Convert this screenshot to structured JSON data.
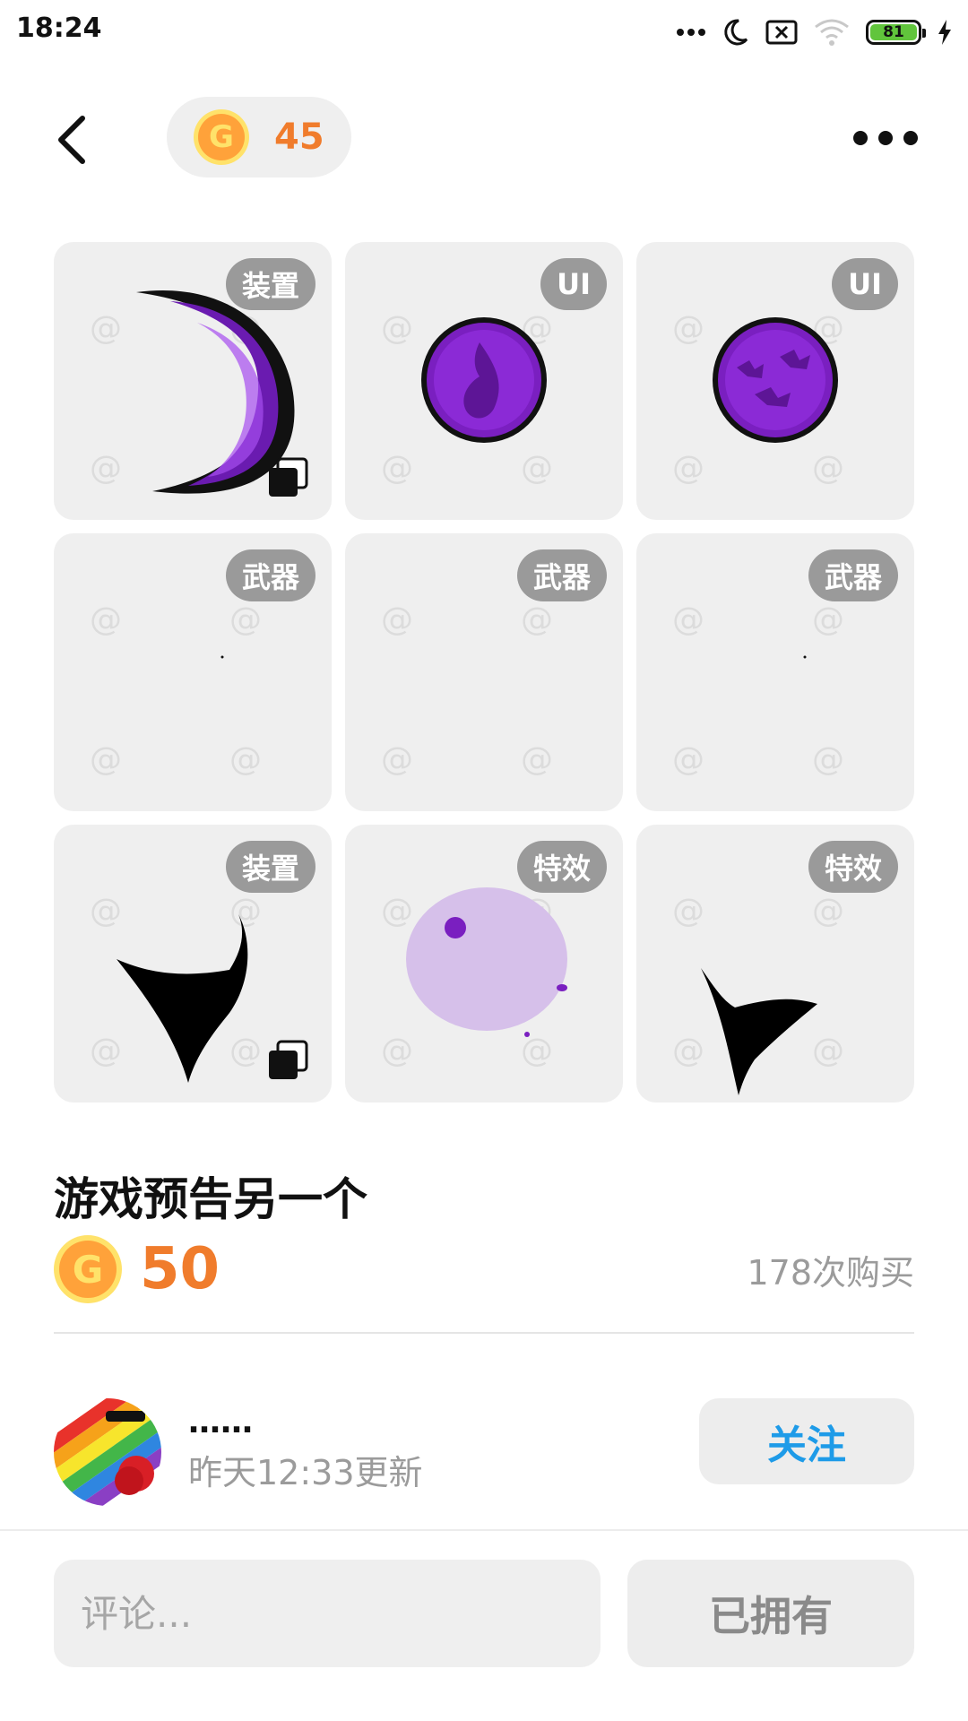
{
  "status_bar": {
    "time": "18:24",
    "battery_level": "81",
    "icons": [
      "more-dots-icon",
      "moon-icon",
      "sim-disabled-icon",
      "wifi-icon",
      "battery-icon",
      "charging-bolt-icon"
    ]
  },
  "header": {
    "back_icon": "chevron-left-icon",
    "coin_symbol": "G",
    "coin_balance": "45",
    "more_icon": "more-horizontal-icon"
  },
  "grid": {
    "items": [
      {
        "tag": "装置",
        "art": "purple-crescent-claw",
        "multi": true
      },
      {
        "tag": "UI",
        "art": "purple-orb-flame",
        "multi": false
      },
      {
        "tag": "UI",
        "art": "purple-orb-bats",
        "multi": false
      },
      {
        "tag": "武器",
        "art": "tiny-dot",
        "multi": false
      },
      {
        "tag": "武器",
        "art": "empty",
        "multi": false
      },
      {
        "tag": "武器",
        "art": "tiny-dot",
        "multi": false
      },
      {
        "tag": "装置",
        "art": "black-shard",
        "multi": true
      },
      {
        "tag": "特效",
        "art": "lavender-bubble",
        "multi": false
      },
      {
        "tag": "特效",
        "art": "black-check-shard",
        "multi": false
      }
    ],
    "watermark": "@"
  },
  "product": {
    "title": "游戏预告另一个",
    "coin_symbol": "G",
    "price": "50",
    "purchases": "178次购买"
  },
  "author": {
    "name": "……",
    "updated": "昨天12:33更新",
    "follow_label": "关注"
  },
  "bottom_bar": {
    "comment_placeholder": "评论...",
    "owned_label": "已拥有"
  },
  "colors": {
    "accent_orange": "#f07c2c",
    "follow_blue": "#1e9be8",
    "tile_bg": "#efefef",
    "tag_bg": "#9a9a9a",
    "purple": "#7a1fc0"
  }
}
